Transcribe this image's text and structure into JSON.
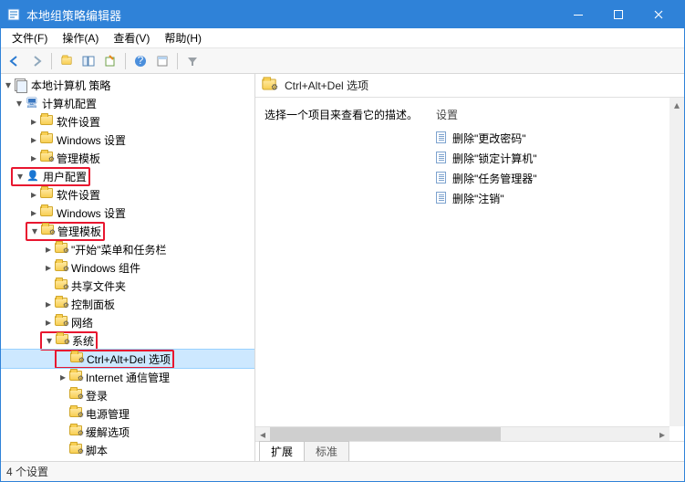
{
  "window": {
    "title": "本地组策略编辑器"
  },
  "menubar": {
    "file": "文件(F)",
    "action": "操作(A)",
    "view": "查看(V)",
    "help": "帮助(H)"
  },
  "tree": {
    "root": "本地计算机 策略",
    "computer_config": "计算机配置",
    "software_settings": "软件设置",
    "windows_settings": "Windows 设置",
    "admin_templates": "管理模板",
    "user_config": "用户配置",
    "start_taskbar": "\"开始\"菜单和任务栏",
    "win_components": "Windows 组件",
    "shared_folders": "共享文件夹",
    "control_panel": "控制面板",
    "network": "网络",
    "system": "系统",
    "cad_options": "Ctrl+Alt+Del 选项",
    "internet_comm": "Internet 通信管理",
    "login": "登录",
    "power_mgmt": "电源管理",
    "mitigation": "缓解选项",
    "scripts": "脚本"
  },
  "right": {
    "header": "Ctrl+Alt+Del 选项",
    "hint": "选择一个项目来查看它的描述。",
    "settings_col": "设置",
    "items": [
      "删除\"更改密码\"",
      "删除\"锁定计算机\"",
      "删除\"任务管理器\"",
      "删除\"注销\""
    ],
    "tab_ext": "扩展",
    "tab_std": "标准"
  },
  "status": "4 个设置"
}
